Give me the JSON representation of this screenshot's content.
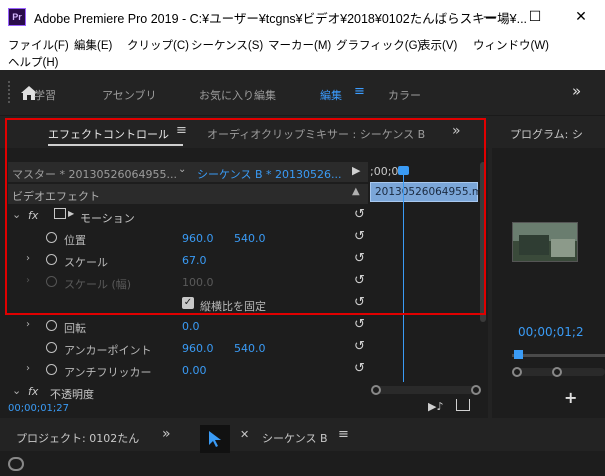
{
  "window": {
    "app_icon": "Pr",
    "title": "Adobe Premiere Pro 2019 - C:¥ユーザー¥tcgns¥ビデオ¥2018¥0102たんばらスキー場¥...",
    "minimize": "—",
    "maximize": "☐",
    "close": "✕"
  },
  "menu": {
    "file": "ファイル(F)",
    "edit": "編集(E)",
    "clip": "クリップ(C)",
    "sequence": "シーケンス(S)",
    "marker": "マーカー(M)",
    "graphics": "グラフィック(G)",
    "view": "表示(V)",
    "window": "ウィンドウ(W)",
    "help": "ヘルプ(H)"
  },
  "workspaces": {
    "learn": "学習",
    "assembly": "アセンブリ",
    "favorite_edit": "お気に入り編集",
    "edit": "編集",
    "color": "カラー",
    "more": "»"
  },
  "effect_controls": {
    "tab_effect": "エフェクトコントロール",
    "tab_audio_mixer": "オーディオクリップミキサー : シーケンス B",
    "tab_more": "»",
    "master_clip": "マスター * 20130526064955...",
    "sequence_clip": "シーケンス B * 20130526...",
    "timecode_ruler": ";00;00",
    "clip_bar_label": "20130526064955.m",
    "section": "ビデオエフェクト",
    "motion": "モーション",
    "position_label": "位置",
    "position_x": "960.0",
    "position_y": "540.0",
    "scale_label": "スケール",
    "scale_value": "67.0",
    "scale_width_label": "スケール (幅)",
    "scale_width_value": "100.0",
    "uniform_scale_label": "縦横比を固定",
    "rotation_label": "回転",
    "rotation_value": "0.0",
    "anchor_label": "アンカーポイント",
    "anchor_x": "960.0",
    "anchor_y": "540.0",
    "antiflicker_label": "アンチフリッカー",
    "antiflicker_value": "0.00",
    "opacity_label": "不透明度",
    "timecode": "00;00;01;27",
    "fx_glyph": "fx"
  },
  "program": {
    "tab": "プログラム: シ",
    "timecode": "00;00;01;2"
  },
  "project": {
    "tab": "プロジェクト: 0102たん",
    "more": "»"
  },
  "timeline": {
    "tab": "シーケンス B"
  },
  "colors": {
    "accent": "#3a9bf5",
    "highlight": "#e00000",
    "panel": "#1d1d1d"
  }
}
